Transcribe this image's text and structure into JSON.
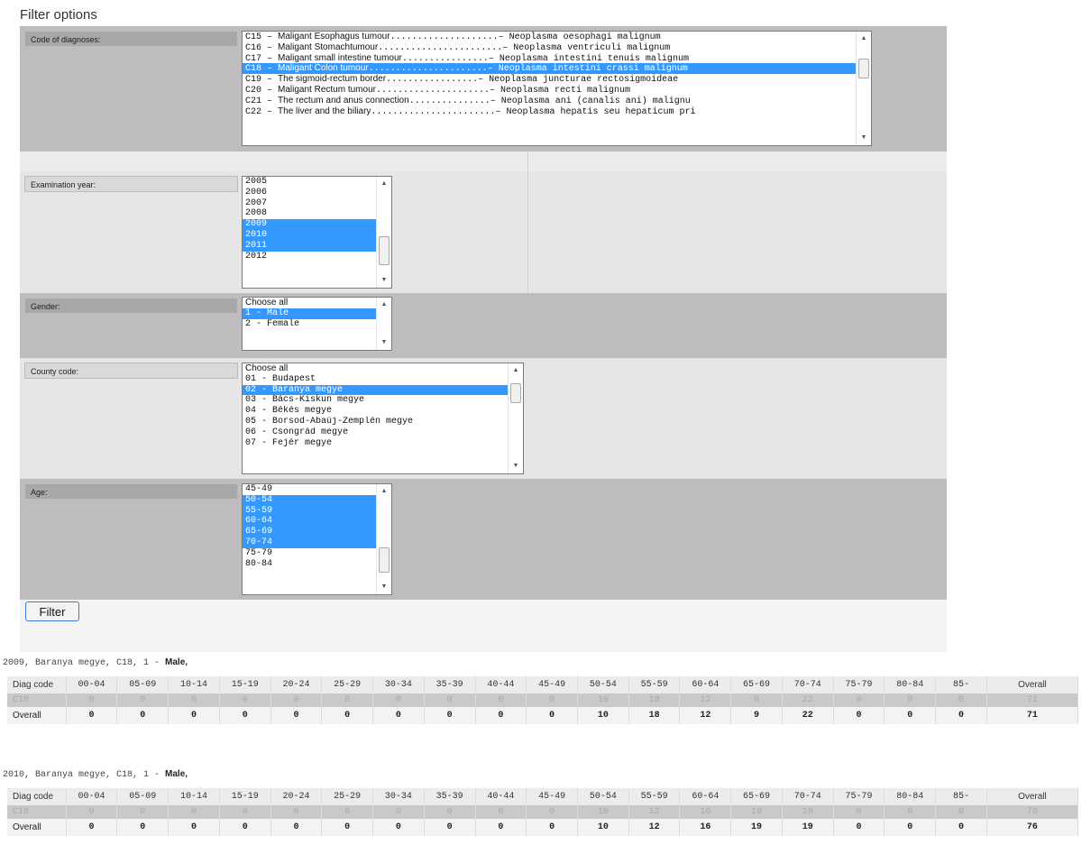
{
  "title": "Filter options",
  "filters": {
    "diagnosis": {
      "label": "Code of diagnoses:",
      "options": [
        {
          "code": "C15",
          "name": "Maligant Esophagus tumour",
          "dots": "....................",
          "latin": "Neoplasma oesophagi malignum",
          "selected": false
        },
        {
          "code": "C16",
          "name": "Maligant Stomachtumour",
          "dots": ".......................",
          "latin": "Neoplasma ventriculi malignum",
          "selected": false
        },
        {
          "code": "C17",
          "name": "Maligant small intestine tumour",
          "dots": "................",
          "latin": "Neoplasma intestini tenuis malignum",
          "selected": false
        },
        {
          "code": "C18",
          "name": "Maligant Colon tumour",
          "dots": "......................",
          "latin": "Neoplasma intestini crassi malignum",
          "selected": true
        },
        {
          "code": "C19",
          "name": "The sigmoid-rectum border",
          "dots": ".................",
          "latin": "Neoplasma juncturae rectosigmoideae",
          "selected": false
        },
        {
          "code": "C20",
          "name": "Maligant Rectum tumour",
          "dots": ".....................",
          "latin": "Neoplasma recti malignum",
          "selected": false
        },
        {
          "code": "C21",
          "name": "The rectum and anus connection",
          "dots": "...............",
          "latin": "Neoplasma ani (canalis ani) malignu",
          "selected": false
        },
        {
          "code": "C22",
          "name": "The liver and the biliary",
          "dots": ".......................",
          "latin": "Neoplasma hepatis seu hepaticum pri",
          "selected": false
        }
      ]
    },
    "year": {
      "label": "Examination year:",
      "options": [
        {
          "text": "2005",
          "selected": false
        },
        {
          "text": "2006",
          "selected": false
        },
        {
          "text": "2007",
          "selected": false
        },
        {
          "text": "2008",
          "selected": false
        },
        {
          "text": "2009",
          "selected": true
        },
        {
          "text": "2010",
          "selected": true
        },
        {
          "text": "2011",
          "selected": true
        },
        {
          "text": "2012",
          "selected": false
        }
      ]
    },
    "gender": {
      "label": "Gender:",
      "options": [
        {
          "text": "Choose all",
          "selected": false,
          "font": "sans"
        },
        {
          "text": "1 - Male",
          "selected": true,
          "font": "mixed"
        },
        {
          "text": "2 - Female",
          "selected": false,
          "font": "mixed"
        }
      ]
    },
    "county": {
      "label": "County code:",
      "options": [
        {
          "text": "Choose all",
          "selected": false,
          "font": "sans"
        },
        {
          "text": "01 - Budapest",
          "selected": false
        },
        {
          "text": "02 - Baranya megye",
          "selected": true
        },
        {
          "text": "03 - Bács-Kiskun megye",
          "selected": false
        },
        {
          "text": "04 - Békés megye",
          "selected": false
        },
        {
          "text": "05 - Borsod-Abaúj-Zemplén megye",
          "selected": false
        },
        {
          "text": "06 - Csongrád megye",
          "selected": false
        },
        {
          "text": "07 - Fejér megye",
          "selected": false
        }
      ]
    },
    "age": {
      "label": "Age:",
      "options": [
        {
          "text": "45-49",
          "selected": false
        },
        {
          "text": "50-54",
          "selected": true
        },
        {
          "text": "55-59",
          "selected": true
        },
        {
          "text": "60-64",
          "selected": true
        },
        {
          "text": "65-69",
          "selected": true
        },
        {
          "text": "70-74",
          "selected": true
        },
        {
          "text": "75-79",
          "selected": false
        },
        {
          "text": "80-84",
          "selected": false
        }
      ]
    }
  },
  "filter_button": "Filter",
  "results": [
    {
      "caption_prefix": "2009, Baranya megye, C18, 1 - ",
      "caption_bold": "Male,",
      "headers": [
        "Diag code",
        "00-04",
        "05-09",
        "10-14",
        "15-19",
        "20-24",
        "25-29",
        "30-34",
        "35-39",
        "40-44",
        "45-49",
        "50-54",
        "55-59",
        "60-64",
        "65-69",
        "70-74",
        "75-79",
        "80-84",
        "85-",
        "Overall"
      ],
      "code_row": [
        "C18",
        "0",
        "0",
        "0",
        "0",
        "0",
        "0",
        "0",
        "0",
        "0",
        "0",
        "10",
        "18",
        "12",
        "9",
        "22",
        "0",
        "0",
        "0",
        "71"
      ],
      "overall_row": [
        "Overall",
        "0",
        "0",
        "0",
        "0",
        "0",
        "0",
        "0",
        "0",
        "0",
        "0",
        "10",
        "18",
        "12",
        "9",
        "22",
        "0",
        "0",
        "0",
        "71"
      ]
    },
    {
      "caption_prefix": "2010, Baranya megye, C18, 1 - ",
      "caption_bold": "Male,",
      "headers": [
        "Diag code",
        "00-04",
        "05-09",
        "10-14",
        "15-19",
        "20-24",
        "25-29",
        "30-34",
        "35-39",
        "40-44",
        "45-49",
        "50-54",
        "55-59",
        "60-64",
        "65-69",
        "70-74",
        "75-79",
        "80-84",
        "85-",
        "Overall"
      ],
      "code_row": [
        "C18",
        "0",
        "0",
        "0",
        "0",
        "0",
        "0",
        "0",
        "0",
        "0",
        "0",
        "10",
        "12",
        "16",
        "19",
        "19",
        "0",
        "0",
        "0",
        "76"
      ],
      "overall_row": [
        "Overall",
        "0",
        "0",
        "0",
        "0",
        "0",
        "0",
        "0",
        "0",
        "0",
        "0",
        "10",
        "12",
        "16",
        "19",
        "19",
        "0",
        "0",
        "0",
        "76"
      ]
    }
  ]
}
